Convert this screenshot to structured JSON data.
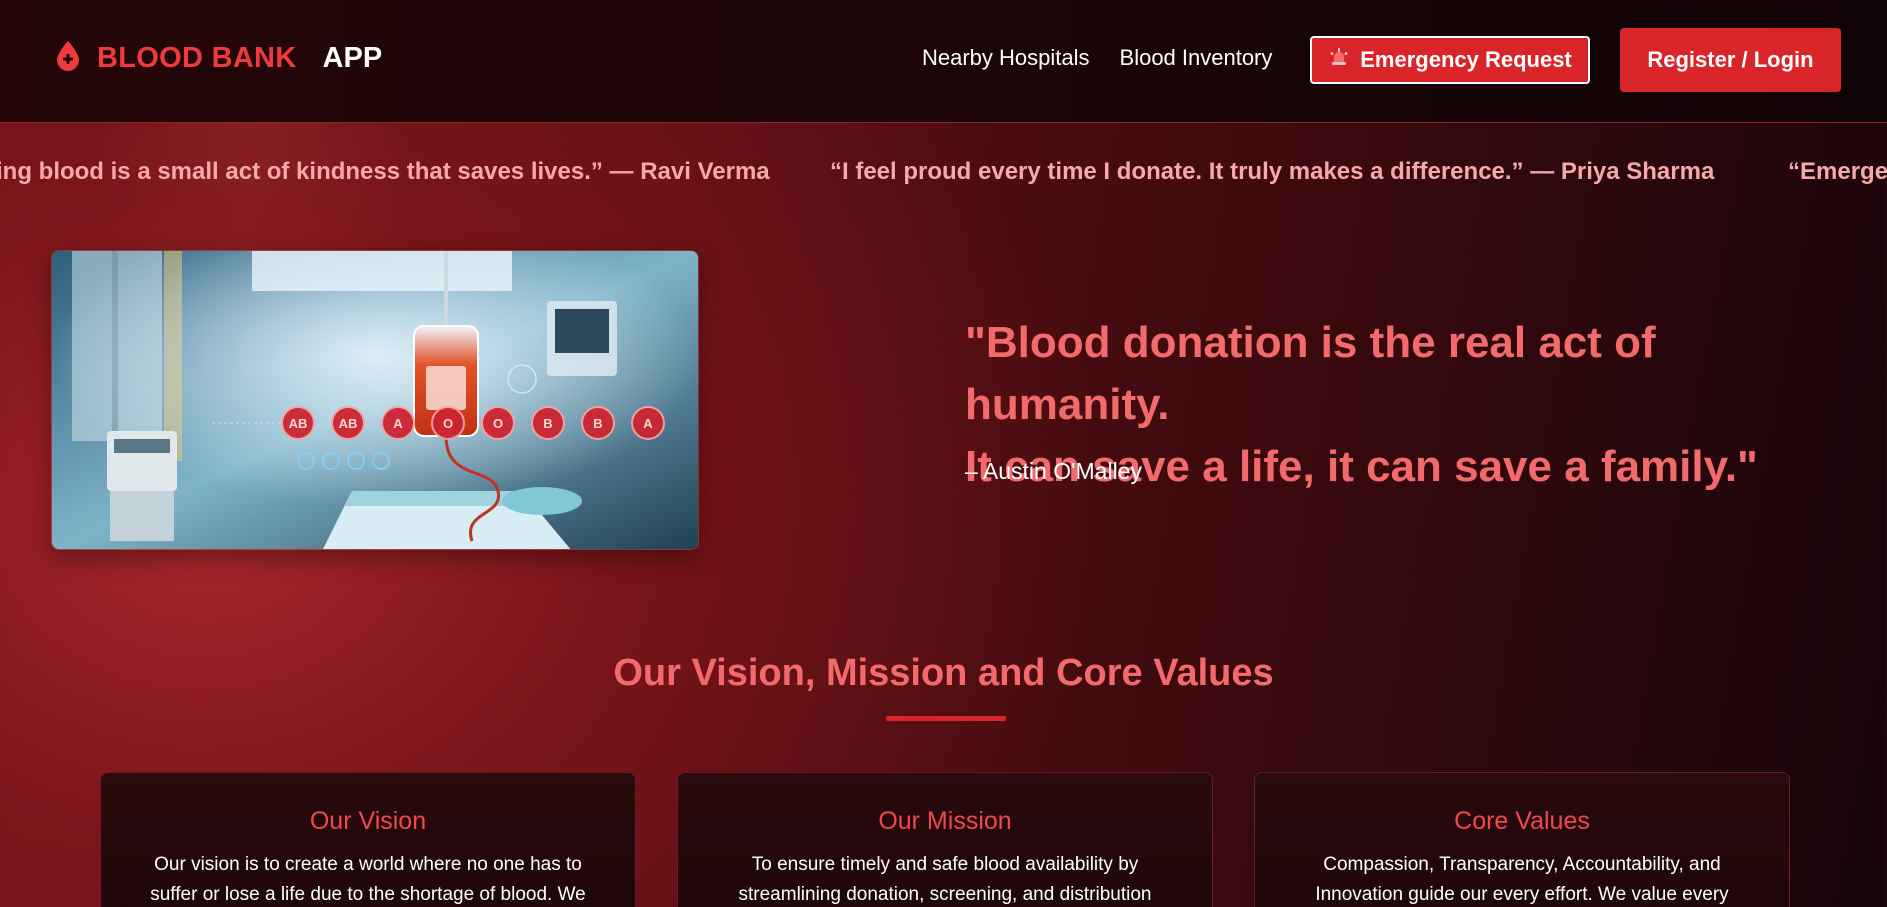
{
  "brand": {
    "name": "BLOOD BANK",
    "app": "APP",
    "icon": "blood-drop-icon"
  },
  "nav": {
    "links": [
      "Nearby Hospitals",
      "Blood Inventory"
    ],
    "emergency": {
      "label": "Emergency Request",
      "icon": "siren-icon"
    },
    "login": "Register / Login"
  },
  "ticker": [
    "ing blood is a small act of kindness that saves lives.” — Ravi Verma",
    "“I feel proud every time I donate. It truly makes a difference.” — Priya Sharma",
    "“Emerge"
  ],
  "hero": {
    "image_groups": [
      "AB",
      "AB",
      "A",
      "O",
      "O",
      "B",
      "B",
      "A"
    ],
    "quote_line1": "\"Blood donation is the real act of humanity.",
    "quote_line2": "It can save a life, it can save a family.\"",
    "author": "– Austin O'Malley"
  },
  "section": {
    "title": "Our Vision, Mission and Core Values",
    "cards": [
      {
        "title": "Our Vision",
        "body": "Our vision is to create a world where no one has to suffer or lose a life due to the shortage of blood. We"
      },
      {
        "title": "Our Mission",
        "body": "To ensure timely and safe blood availability by streamlining donation, screening, and distribution"
      },
      {
        "title": "Core Values",
        "body": "Compassion, Transparency, Accountability, and Innovation guide our every effort. We value every"
      }
    ]
  },
  "colors": {
    "accent": "#d9252a",
    "brand_red": "#ef3b3e",
    "quote": "#f26a6c",
    "ticker": "#f7a8a8"
  }
}
